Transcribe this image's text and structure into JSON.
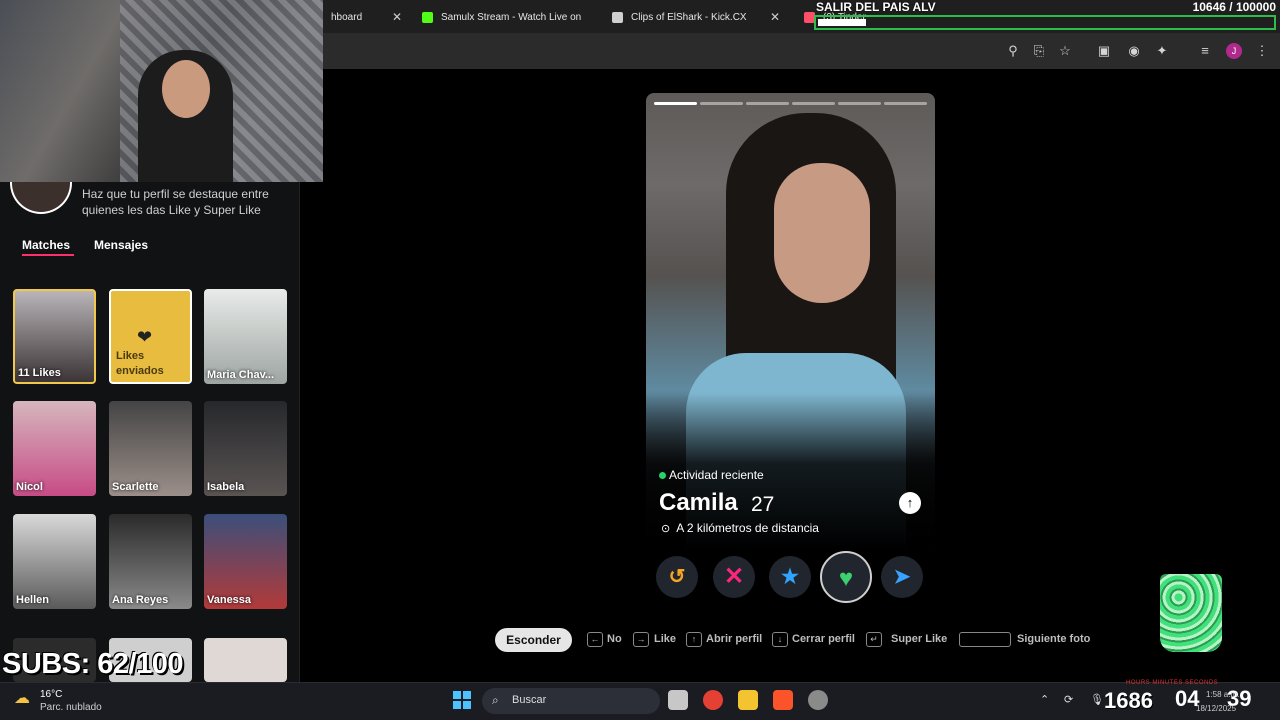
{
  "browser": {
    "tabs": [
      {
        "label": "hboard",
        "favicon_color": "#1f1f1f"
      },
      {
        "label": "Samulx Stream - Watch Live on",
        "favicon_color": "#53fc18"
      },
      {
        "label": "Clips of ElShark - Kick.CX",
        "favicon_color": "#cfcfcf"
      },
      {
        "label": "(3) Tinder",
        "favicon_color": "#fd5068"
      }
    ],
    "profile_initial": "J"
  },
  "overlay": {
    "goal_title": "SALIR DEL PAIS ALV",
    "goal_count": "10646  / 100000",
    "goal_progress": 0.106,
    "subs": "SUBS: 62/100"
  },
  "sidebar": {
    "promo_text": "Haz que tu perfil se destaque entre quienes les das Like y Super Like",
    "tabs": {
      "matches": "Matches",
      "messages": "Mensajes"
    },
    "cards": [
      {
        "name": "11 Likes"
      },
      {
        "name": "Likes enviados"
      },
      {
        "name": "Maria Chav..."
      },
      {
        "name": "Nicol"
      },
      {
        "name": "Scarlette"
      },
      {
        "name": "Isabela"
      },
      {
        "name": "Hellen"
      },
      {
        "name": "Ana Reyes"
      },
      {
        "name": "Vanessa"
      }
    ]
  },
  "profile": {
    "activity": "Actividad reciente",
    "name": "Camila",
    "age": "27",
    "distance": "A 2 kilómetros de distancia",
    "photo_count": 6,
    "active_photo": 0
  },
  "shortcuts": {
    "hide": "Esconder",
    "no": "No",
    "like": "Like",
    "open": "Abrir perfil",
    "close": "Cerrar perfil",
    "superlike": "Super Like",
    "next": "Siguiente foto"
  },
  "taskbar": {
    "weather_temp": "16°C",
    "weather_desc": "Parc. nublado",
    "search": "Buscar",
    "timer_hours": "1686",
    "timer_minutes": "04",
    "timer_seconds": "39",
    "timer_labels": "HOURS    MINUTES    SECONDS",
    "time": "1:58 a.m.",
    "date": "18/12/2025"
  },
  "colors": {
    "accent": "#fd2f6c",
    "like": "#3cd070",
    "superlike": "#31a4ff",
    "rewind": "#f5a623",
    "goal_border": "#2ebd48"
  }
}
